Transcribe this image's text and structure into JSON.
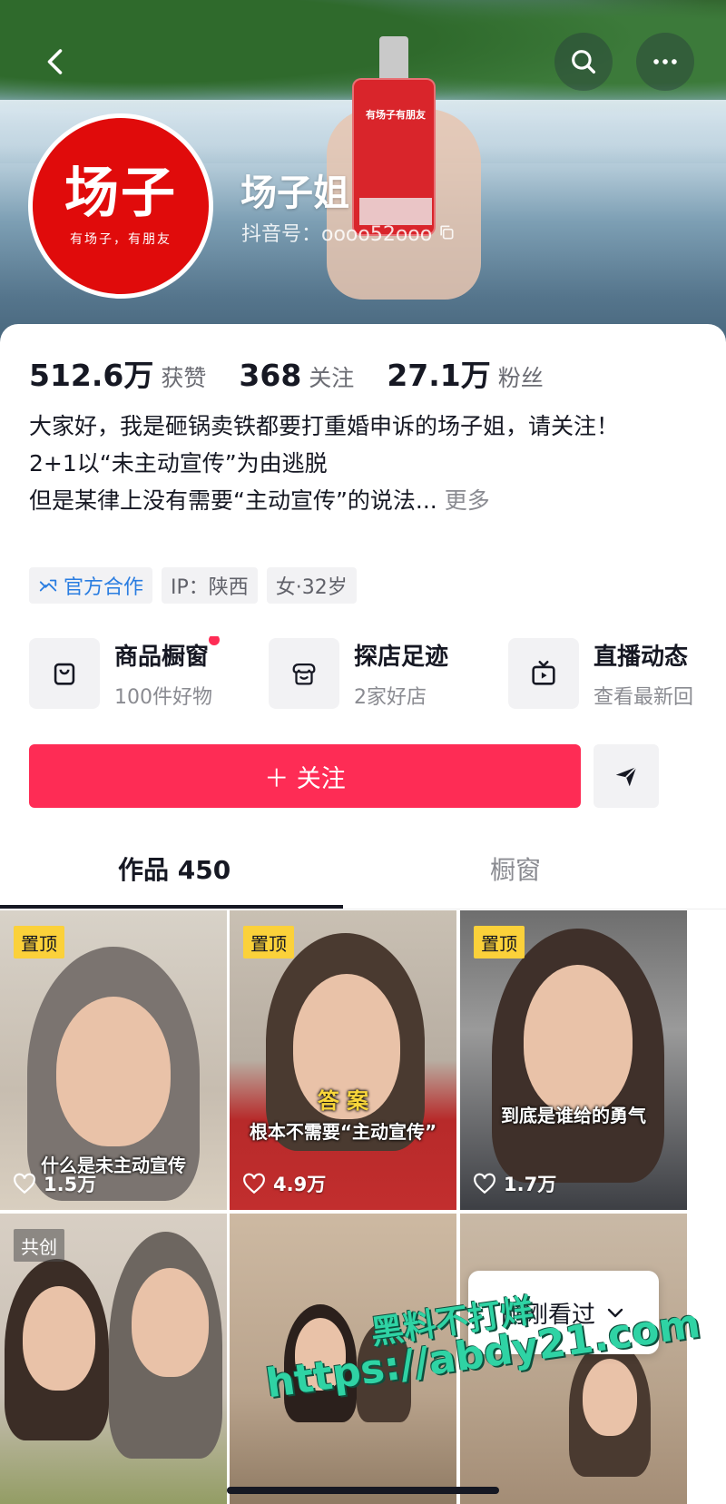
{
  "profile": {
    "avatar_text": "场子",
    "avatar_subtext": "有场子，有朋友",
    "bottle_label": "有场子有朋友",
    "name": "场子姐",
    "douyin_id": "抖音号：oooo52ooo"
  },
  "stats": [
    {
      "value": "512.6万",
      "label": "获赞"
    },
    {
      "value": "368",
      "label": "关注"
    },
    {
      "value": "27.1万",
      "label": "粉丝"
    }
  ],
  "bio": {
    "line1": "大家好，我是砸锅卖铁都要打重婚申诉的场子姐，请关注！",
    "line2": "2+1以“未主动宣传”为由逃脱",
    "line3": "但是某律上没有需要“主动宣传”的说法...",
    "more": "更多"
  },
  "tags": {
    "official": "官方合作",
    "ip": "IP：陕西",
    "gender_age": "女·32岁"
  },
  "features": [
    {
      "title": "商品橱窗",
      "sub": "100件好物",
      "icon": "shopping-bag-icon"
    },
    {
      "title": "探店足迹",
      "sub": "2家好店",
      "icon": "store-icon"
    },
    {
      "title": "直播动态",
      "sub": "查看最新回",
      "icon": "tv-icon"
    }
  ],
  "actions": {
    "follow": "＋ 关注",
    "share_icon": "send-icon"
  },
  "tabs": {
    "works": "作品 450",
    "window": "橱窗"
  },
  "videos": [
    {
      "badge": "置顶",
      "likes": "1.5万",
      "caption": "什么是未主动宣传"
    },
    {
      "badge": "置顶",
      "likes": "4.9万",
      "caption_top": "答  案",
      "caption": "根本不需要“主动宣传”"
    },
    {
      "badge": "置顶",
      "likes": "1.7万",
      "caption": "到底是谁给的勇气"
    },
    {
      "badge": "共创"
    },
    {},
    {}
  ],
  "seen_pill": "刚刚看过",
  "watermark": {
    "line1": "黑料不打烊",
    "line2": "https://abdy21.com"
  },
  "colors": {
    "accent": "#fe2c55",
    "pin_badge": "#fbd13a",
    "official_blue": "#2a7de1",
    "avatar_red": "#e00b0b"
  }
}
